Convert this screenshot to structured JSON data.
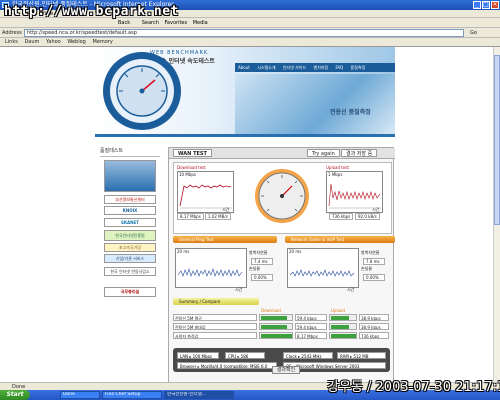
{
  "window": {
    "title": "한국전산원-인터넷 품질테스트 - Microsoft Internet Explorer",
    "watermark": "http://www.bcpark.net",
    "datestamp": "강우동 / 2003-07-30 21:17:17"
  },
  "menubar": {
    "items": [
      "File",
      "Edit",
      "View",
      "Favorites",
      "Tools",
      "Help"
    ]
  },
  "toolbar": {
    "back": "Back",
    "search": "Search",
    "favorites": "Favorites",
    "media": "Media"
  },
  "address": {
    "label": "Address",
    "value": "http://speed.nca.or.kr/speedtest/default.asp",
    "go": "Go"
  },
  "links": {
    "items": [
      "Links",
      "Daum",
      "Yahoo",
      "Weblog",
      "Memory"
    ]
  },
  "header": {
    "brand_small": "WEB BENCHMARK",
    "brand_title": "초고속 인터넷 속도테스트",
    "nav": [
      "About",
      "시스템소개",
      "인터넷 가이드",
      "벤치마킹",
      "FAQ",
      "품질측정"
    ],
    "hero_text": "전용선 품질측정"
  },
  "sidebar": {
    "title": "품질테스트",
    "banners": [
      "부산정보통신센터",
      "KNOIX",
      "SKANET",
      "한국인터넷진흥원",
      "초고속국가망",
      "기업/기관 서비스",
      "한국 인터넷 연동사업소",
      "국무총리실"
    ]
  },
  "main": {
    "tab_wan": "WAN TEST",
    "tab_try": "Try again",
    "tab_result": "결과 저장 중",
    "download": {
      "label": "Download test",
      "scale": "10 Mbps",
      "value1": "8.17 Mbps",
      "value2": "1.02 MB/s",
      "axis": "시간"
    },
    "upload": {
      "label": "Upload test",
      "scale": "1 Mbps",
      "value1": "736 kbps",
      "value2": "92.0 kB/s",
      "axis": "시간"
    },
    "ping_bar": "General Ping Test",
    "gaming_bar": "Network Game & VoIP Test",
    "left_stats": {
      "jitter_label": "왕복지연율",
      "jitter_value": "7.4 ms",
      "loss_label": "손실율",
      "loss_value": "0.00%",
      "axis": "시간"
    },
    "right_stats": {
      "jitter_label": "왕복지연율",
      "jitter_value": "7.8 ms",
      "loss_label": "손실율",
      "loss_value": "0.00%",
      "axis": "시간"
    },
    "small_scale": "20 ms",
    "summary_bar": "Summary / Compare",
    "table": {
      "header_download": "Download",
      "header_upload": "Upload",
      "rows": [
        {
          "label": "전용선 5M 평균",
          "down": "59.4 kbps",
          "up": "38.9 kbps",
          "down_fill": 0.78,
          "up_fill": 0.66
        },
        {
          "label": "전용선 5M 최대값",
          "down": "59.4 kbps",
          "up": "38.9 kbps",
          "down_fill": 0.78,
          "up_fill": 0.66
        },
        {
          "label": "사용자 측정값",
          "down": "8.17 Mbps",
          "up": "736 kbps",
          "down_fill": 1.0,
          "up_fill": 1.0
        }
      ]
    },
    "system": {
      "lan": "LAN ▸ 100 Mbps",
      "cpu": "CPU ▸ 586",
      "clock": "Clock ▸ 2543 MHz",
      "ram": "RAM ▸ 512 MB",
      "browser": "Browser ▸ Mozilla/4.0 (compatible; MSIE 6.0",
      "os": "OS ▸ Microsoft Windows Server 2003"
    },
    "confirm_label": "결과확인"
  },
  "statusbar": {
    "text": "Done"
  },
  "taskbar": {
    "start": "Start",
    "items": [
      "Done",
      "Fine Chef Setup",
      "한국전산원-인터넷..."
    ]
  },
  "colors": {
    "accent": "#1b5d9b",
    "download_line": "#b01020",
    "upload_line": "#b01020",
    "orange": "#de7d12",
    "green_bar": "#3da13d"
  }
}
